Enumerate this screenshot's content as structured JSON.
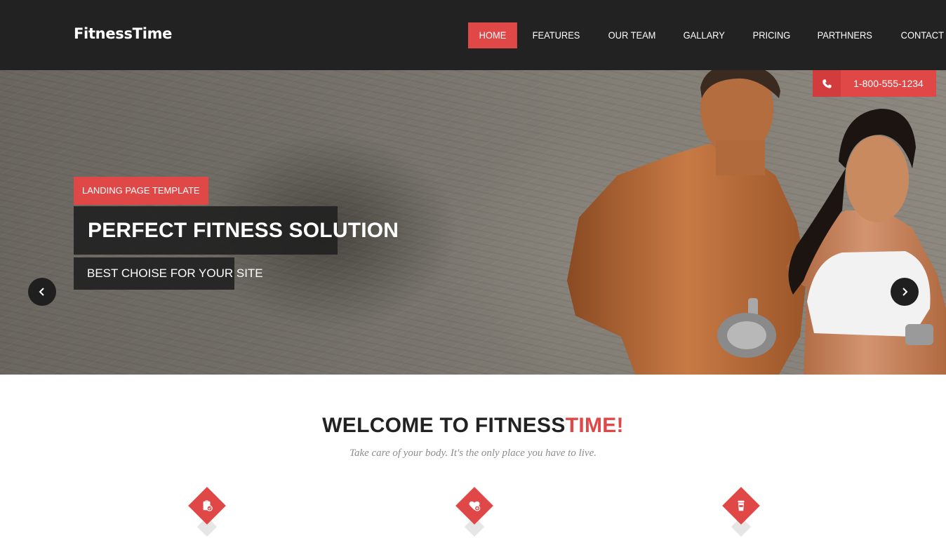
{
  "header": {
    "logo": "FitnessTime",
    "nav": [
      {
        "label": "HOME",
        "active": true
      },
      {
        "label": "FEATURES",
        "active": false
      },
      {
        "label": "OUR TEAM",
        "active": false
      },
      {
        "label": "GALLARY",
        "active": false
      },
      {
        "label": "PRICING",
        "active": false
      },
      {
        "label": "PARTHNERS",
        "active": false
      },
      {
        "label": "CONTACT",
        "active": false
      }
    ]
  },
  "hero": {
    "tag": "LANDING PAGE TEMPLATE",
    "title": "PERFECT FITNESS SOLUTION",
    "subtitle": "BEST CHOISE FOR YOUR SITE",
    "phone": "1-800-555-1234",
    "icons": {
      "prev": "chevron-left-icon",
      "next": "chevron-right-icon",
      "phone": "phone-icon"
    }
  },
  "welcome": {
    "title_main": "WELCOME TO FITNESS",
    "title_accent": "TIME!",
    "subtitle": "Take care of your body. It's the only place you have to live.",
    "features": [
      {
        "icon": "clipboard-check-icon"
      },
      {
        "icon": "heart-plus-icon"
      },
      {
        "icon": "protein-shaker-icon"
      }
    ]
  },
  "colors": {
    "accent": "#e04848",
    "header_bg": "#222222",
    "dark_box": "#222222",
    "muted_text": "#8c8c8c"
  }
}
